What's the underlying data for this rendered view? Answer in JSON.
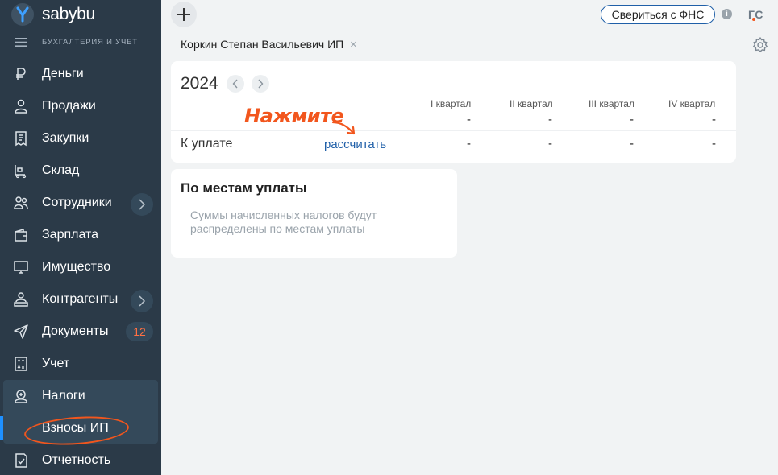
{
  "sidebar": {
    "logo": "sabybu",
    "subtitle": "БУХГАЛТЕРИЯ И УЧЕТ",
    "items": [
      {
        "label": "Деньги"
      },
      {
        "label": "Продажи"
      },
      {
        "label": "Закупки"
      },
      {
        "label": "Склад"
      },
      {
        "label": "Сотрудники"
      },
      {
        "label": "Зарплата"
      },
      {
        "label": "Имущество"
      },
      {
        "label": "Контрагенты"
      },
      {
        "label": "Документы",
        "badge": "12"
      },
      {
        "label": "Учет"
      },
      {
        "label": "Налоги"
      },
      {
        "label": "Взносы ИП"
      },
      {
        "label": "Отчетность"
      }
    ]
  },
  "topbar": {
    "fns_button": "Свериться с ФНС",
    "info": "i",
    "avatar": "ГС",
    "person": "Коркин Степан Васильевич ИП",
    "close": "×"
  },
  "main": {
    "year": "2024",
    "quarters": [
      "I квартал",
      "II квартал",
      "III квартал",
      "IV квартал"
    ],
    "accrued": [
      "-",
      "-",
      "-",
      "-"
    ],
    "to_pay_label": "К уплате",
    "calc_link": "рассчитать",
    "to_pay": [
      "-",
      "-",
      "-",
      "-"
    ],
    "hint": "Нажмите"
  },
  "places": {
    "title": "По местам уплаты",
    "text": "Суммы начисленных налогов будут распределены по местам уплаты"
  },
  "colors": {
    "sidebar_bg": "#2b3a48",
    "accent_orange": "#f2561d",
    "link_blue": "#1f5fa8",
    "active_bar": "#1e90ff"
  }
}
